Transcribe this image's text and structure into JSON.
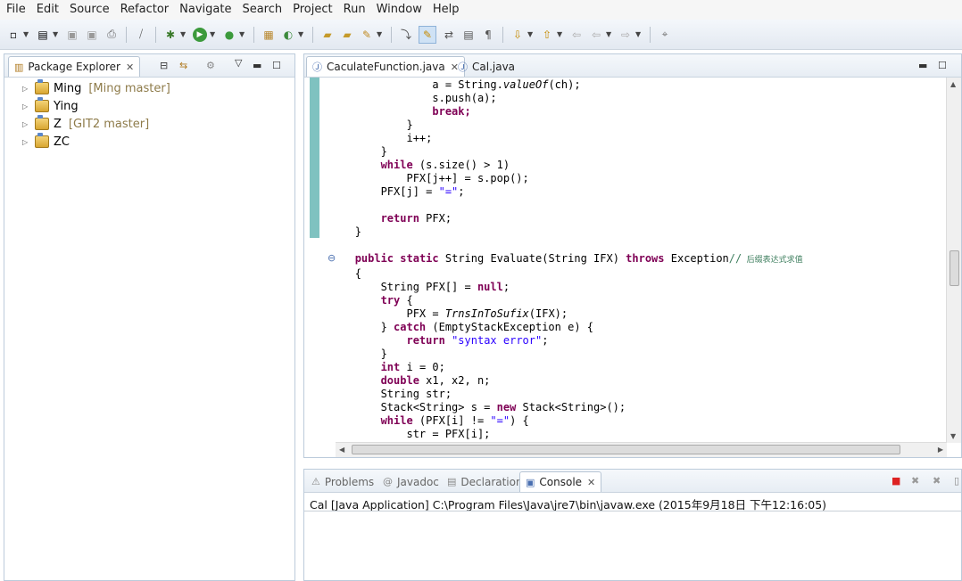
{
  "menu": [
    "File",
    "Edit",
    "Source",
    "Refactor",
    "Navigate",
    "Search",
    "Project",
    "Run",
    "Window",
    "Help"
  ],
  "package_explorer": {
    "tab_label": "Package Explorer",
    "projects": [
      {
        "name": "Ming",
        "branch": "[Ming master]"
      },
      {
        "name": "Ying",
        "branch": ""
      },
      {
        "name": "Z",
        "branch": "[GIT2 master]"
      },
      {
        "name": "ZC",
        "branch": ""
      }
    ]
  },
  "editor": {
    "tabs": [
      {
        "label": "CaculateFunction.java",
        "active": true
      },
      {
        "label": "Cal.java",
        "active": false
      }
    ],
    "lines": [
      "a = String.valueOf(ch);",
      "s.push(a);",
      "break;",
      "}",
      "i++;",
      "}",
      "while (s.size() > 1)",
      "PFX[j++] = s.pop();",
      "PFX[j] = \"=\";",
      "",
      "return PFX;",
      "}",
      "",
      "public static String Evaluate(String IFX) throws Exception// 后缀表达式求值",
      "{",
      "String PFX[] = null;",
      "try {",
      "PFX = TrnsInToSufix(IFX);",
      "} catch (EmptyStackException e) {",
      "return \"syntax error\";",
      "}",
      "int i = 0;",
      "double x1, x2, n;",
      "String str;",
      "Stack<String> s = new Stack<String>();",
      "while (PFX[i] != \"=\") {",
      "str = PFX[i];"
    ]
  },
  "bottom_panel": {
    "tabs": [
      "Problems",
      "Javadoc",
      "Declaration",
      "Console"
    ],
    "active_tab": "Console",
    "console_text": "Cal [Java Application] C:\\Program Files\\Java\\jre7\\bin\\javaw.exe (2015年9月18日 下午12:16:05)"
  },
  "colors": {
    "keyword": "#7f0055",
    "string": "#2a00ff",
    "comment": "#3f7f5f",
    "branch_label": "#8e7b4a",
    "change_bar": "#7fc2c0"
  }
}
